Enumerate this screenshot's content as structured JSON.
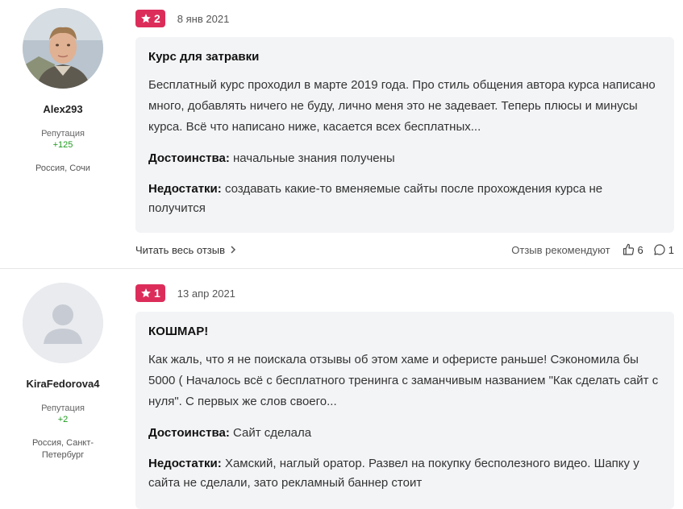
{
  "reviews": [
    {
      "user": {
        "name": "Alex293",
        "rep_label": "Репутация",
        "rep_value": "+125",
        "city": "Россия, Сочи"
      },
      "rating": "2",
      "date": "8 янв 2021",
      "title": "Курс для затравки",
      "text": "Бесплатный курс проходил в марте 2019 года. Про стиль общения автора курса написано много, добавлять ничего не буду, лично меня это не задевает. Теперь плюсы и минусы курса. Всё что написано ниже, касается всех бесплатных...",
      "pros_label": "Достоинства:",
      "pros": "начальные знания получены",
      "cons_label": "Недостатки:",
      "cons": "создавать какие-то вменяемые сайты после прохождения курса не получится",
      "read_more": "Читать весь отзыв",
      "recommend": "Отзыв рекомендуют",
      "likes": "6",
      "comments": "1"
    },
    {
      "user": {
        "name": "KiraFedorova4",
        "rep_label": "Репутация",
        "rep_value": "+2",
        "city": "Россия, Санкт-Петербург"
      },
      "rating": "1",
      "date": "13 апр 2021",
      "title": "КОШМАР!",
      "text": "Как жаль, что я не поискала отзывы об этом хаме и оферисте раньше! Сэкономила бы 5000 ( Началось всё с бесплатного тренинга с заманчивым названием \"Как сделать сайт с нуля\". С первых же слов своего...",
      "pros_label": "Достоинства:",
      "pros": "Сайт сделала",
      "cons_label": "Недостатки:",
      "cons": "Хамский, наглый оратор. Развел на покупку бесполезного видео. Шапку у сайта не сделали, зато рекламный баннер стоит"
    }
  ],
  "colors": {
    "badge": "#dc2d5a",
    "rep_positive": "#1e9a1e",
    "card_bg": "#f3f4f6"
  },
  "icons": {
    "rating": "star-icon",
    "read_more": "chevron-right-icon",
    "like": "thumbs-up-icon",
    "comment": "comment-icon"
  }
}
